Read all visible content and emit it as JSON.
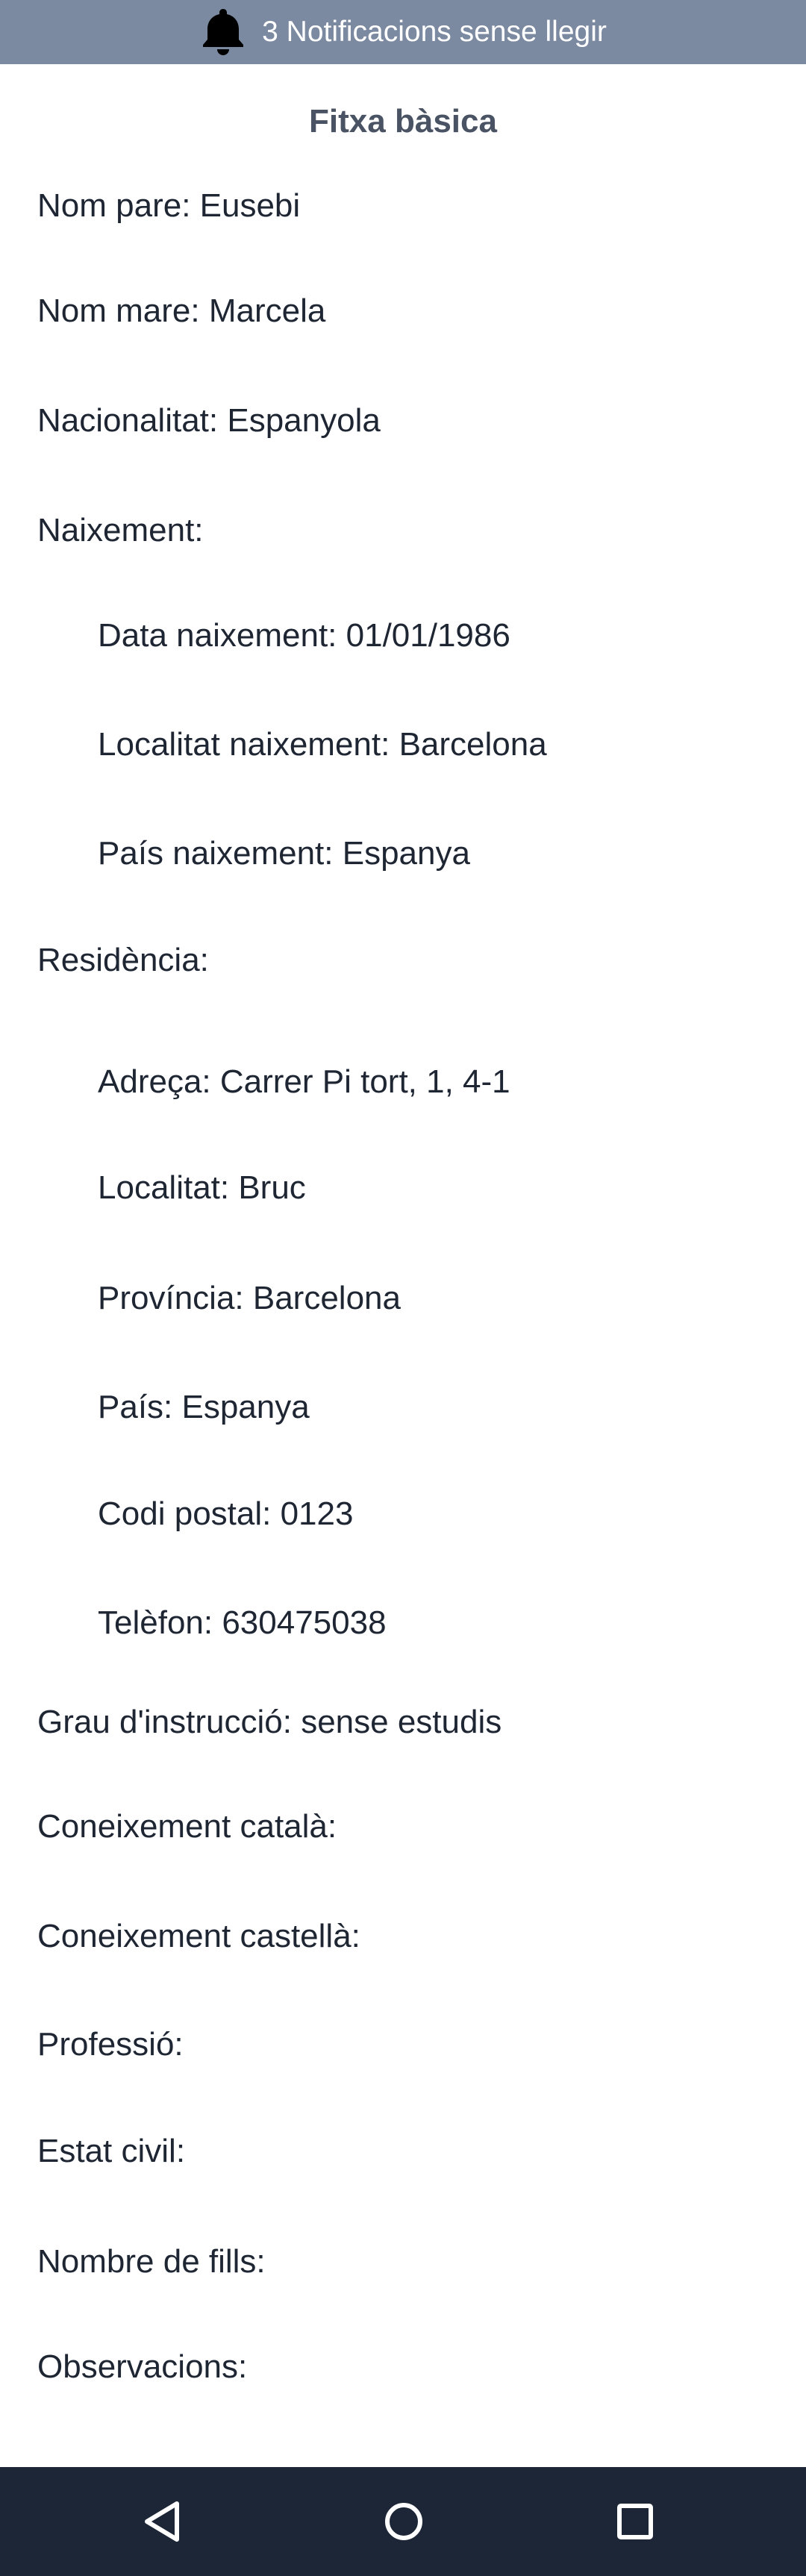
{
  "notifications": {
    "text": "3 Notificacions sense llegir",
    "icon": "bell-icon"
  },
  "title": "Fitxa bàsica",
  "fields": {
    "nom_pare": "Nom pare: Eusebi",
    "nom_mare": "Nom mare: Marcela",
    "nacionalitat": "Nacionalitat: Espanyola",
    "naixement": "Naixement:",
    "data_naixement": "Data naixement: 01/01/1986",
    "localitat_naixement": "Localitat naixement: Barcelona",
    "pais_naixement": "País naixement: Espanya",
    "residencia": "Residència:",
    "adreca": "Adreça: Carrer Pi tort, 1, 4-1",
    "localitat": "Localitat: Bruc",
    "provincia": "Província: Barcelona",
    "pais": "País: Espanya",
    "codi_postal": "Codi postal: 0123",
    "telefon": "Telèfon: 630475038",
    "grau_instruccio": "Grau d'instrucció: sense estudis",
    "coneixement_catala": "Coneixement català:",
    "coneixement_castella": "Coneixement castellà:",
    "professio": "Professió:",
    "estat_civil": "Estat civil:",
    "nombre_fills": "Nombre de fills:",
    "observacions": "Observacions:"
  },
  "nav_bar": {
    "buttons": [
      "back-icon",
      "home-icon",
      "recent-apps-icon"
    ]
  },
  "colors": {
    "notification_bar": "#7c8aa1",
    "nav_bar": "#1c2637",
    "title": "#4a5363",
    "text": "#1f2633"
  }
}
